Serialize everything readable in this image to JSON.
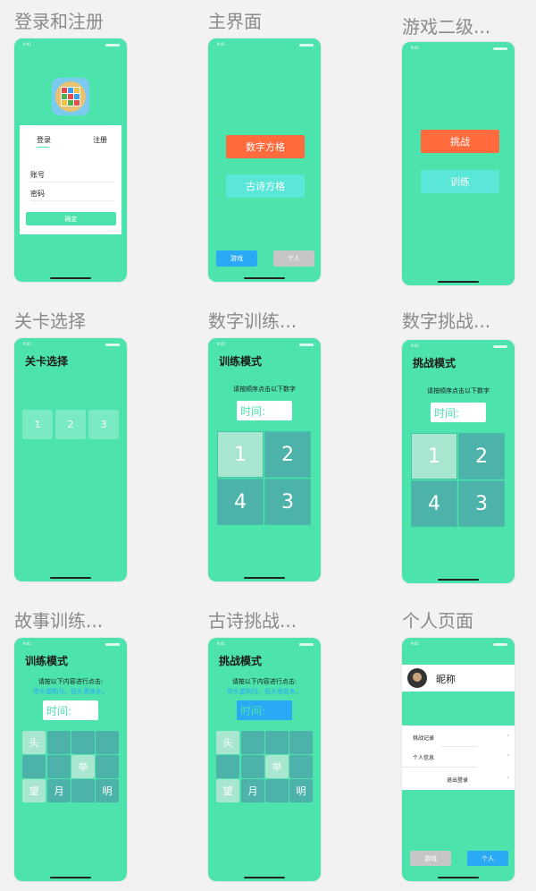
{
  "screens": {
    "login": {
      "caption": "登录和注册",
      "tab_login": "登录",
      "tab_register": "注册",
      "field_account": "账号",
      "field_password": "密码",
      "confirm": "确定"
    },
    "main": {
      "caption": "主界面",
      "number_grid": "数字方格",
      "poem_grid": "古诗方格",
      "nav_game": "游戏",
      "nav_personal": "个人"
    },
    "game_level2": {
      "caption": "游戏二级...",
      "challenge": "挑战",
      "training": "训练"
    },
    "level_select": {
      "caption": "关卡选择",
      "title": "关卡选择",
      "levels": [
        "1",
        "2",
        "3"
      ]
    },
    "number_training": {
      "caption": "数字训练...",
      "title": "训练模式",
      "instruction": "请按顺序点击以下数字",
      "timer_label": "时间:",
      "tiles": [
        "1",
        "2",
        "4",
        "3"
      ]
    },
    "number_challenge": {
      "caption": "数字挑战...",
      "title": "挑战模式",
      "instruction": "请按顺序点击以下数字",
      "timer_label": "时间:",
      "tiles": [
        "1",
        "2",
        "4",
        "3"
      ]
    },
    "story_training": {
      "caption": "故事训练...",
      "title": "训练模式",
      "instruction": "请按以下内容进行点击:",
      "poem": "举头望明月。低头思故乡。",
      "timer_label": "时间:",
      "tiles": [
        "头",
        "",
        "",
        "",
        "",
        "",
        "举",
        "",
        "望",
        "月",
        "",
        "明"
      ]
    },
    "poem_challenge": {
      "caption": "古诗挑战...",
      "title": "挑战模式",
      "instruction": "请按以下内容进行点击:",
      "poem": "举头望明月。低头思故乡。",
      "timer_label": "时间:",
      "tiles": [
        "头",
        "",
        "",
        "",
        "",
        "",
        "举",
        "",
        "望",
        "月",
        "",
        "明"
      ]
    },
    "personal": {
      "caption": "个人页面",
      "nickname": "昵称",
      "menu": [
        "挑战记录",
        "个人信息",
        "退出登录"
      ],
      "nav_game": "游戏",
      "nav_personal": "个人"
    }
  },
  "status_time": "9:41",
  "colors": {
    "screen_bg": "#4de3ad",
    "orange": "#ff6b3d",
    "teal": "#5ae7d8",
    "blue": "#2aa9f5",
    "tile": "#4db3aa",
    "tile_active": "#a8e6cf"
  }
}
